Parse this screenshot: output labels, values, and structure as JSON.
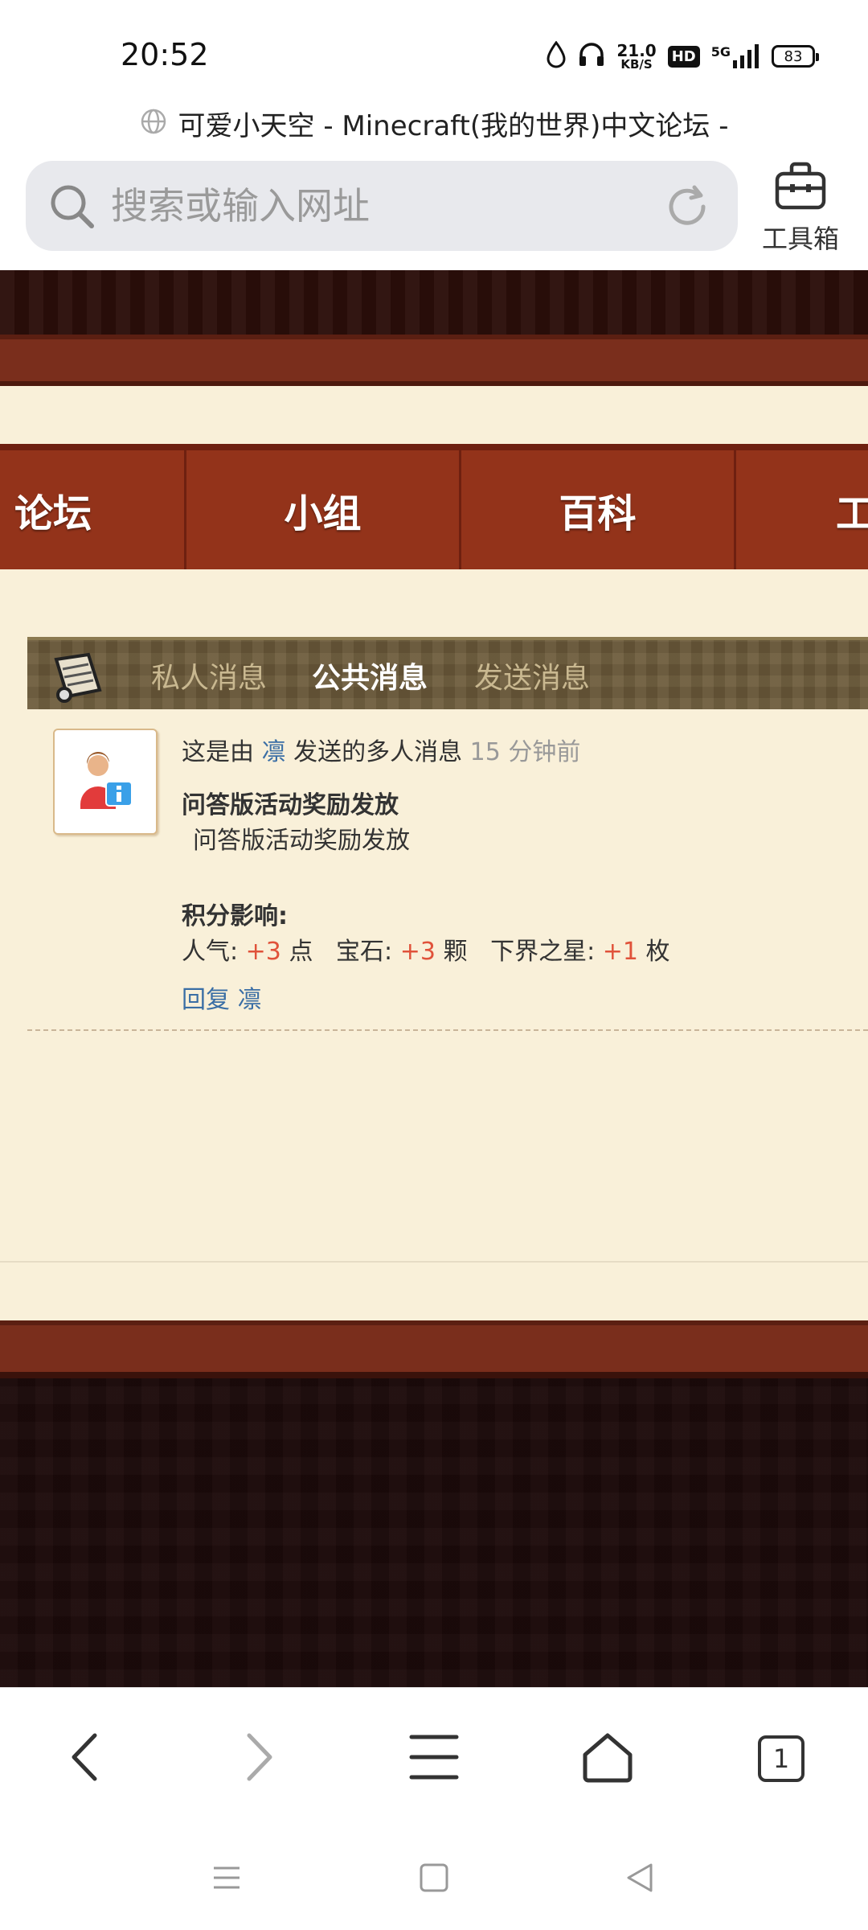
{
  "status_bar": {
    "time": "20:52",
    "net_speed_value": "21.0",
    "net_speed_unit": "KB/S",
    "hd_badge": "HD",
    "network": "5G",
    "battery": "83"
  },
  "browser": {
    "page_title": "可爱小天空 - Minecraft(我的世界)中文论坛 -",
    "search_placeholder": "搜索或输入网址",
    "toolbox_label": "工具箱",
    "tab_count": "1"
  },
  "site": {
    "nav": [
      "论坛",
      "小组",
      "百科",
      "工"
    ],
    "tabs": {
      "private": "私人消息",
      "public": "公共消息",
      "send": "发送消息"
    }
  },
  "message": {
    "prefix": "这是由",
    "sender": "凛",
    "suffix": "发送的多人消息",
    "time": "15 分钟前",
    "title": "问答版活动奖励发放",
    "body": "问答版活动奖励发放",
    "score_label": "积分影响:",
    "scores": [
      {
        "name": "人气:",
        "value": "+3",
        "unit": "点"
      },
      {
        "name": "宝石:",
        "value": "+3",
        "unit": "颗"
      },
      {
        "name": "下界之星:",
        "value": "+1",
        "unit": "枚"
      }
    ],
    "reply_label": "回复",
    "reply_target": "凛"
  },
  "colors": {
    "page_bg": "#f9f0d9",
    "nav_bg": "#93331a",
    "link": "#3a6ea5",
    "plus": "#e0523a"
  }
}
